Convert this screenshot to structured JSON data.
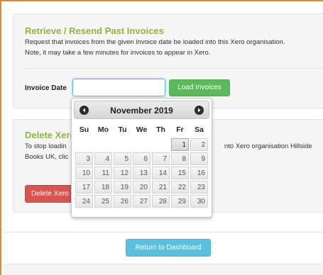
{
  "retrieve": {
    "title": "Retrieve / Resend Past Invoices",
    "description_line1": "Request that invoices from the given invoice date be loaded into this Xero organisation.",
    "description_line2": "Note, it may take a few minutes for invoices to appear in Xero.",
    "invoice_date_label": "Invoice Date",
    "invoice_date_value": "",
    "load_button": "Load Invoices"
  },
  "delete": {
    "title": "Delete Xero",
    "description_line1_left": "To stop loadin",
    "description_line1_right": "nto Xero organisation Hillside",
    "description_line2": "Books UK, clic",
    "delete_button": "Delete Xero"
  },
  "footer": {
    "dashboard_button": "Return to Dashboard"
  },
  "datepicker": {
    "month_title": "November 2019",
    "weekdays": [
      "Su",
      "Mo",
      "Tu",
      "We",
      "Th",
      "Fr",
      "Sa"
    ],
    "weeks": [
      [
        "",
        "",
        "",
        "",
        "",
        "1",
        "2"
      ],
      [
        "3",
        "4",
        "5",
        "6",
        "7",
        "8",
        "9"
      ],
      [
        "10",
        "11",
        "12",
        "13",
        "14",
        "15",
        "16"
      ],
      [
        "17",
        "18",
        "19",
        "20",
        "21",
        "22",
        "23"
      ],
      [
        "24",
        "25",
        "26",
        "27",
        "28",
        "29",
        "30"
      ]
    ],
    "selected_day": "1"
  },
  "colors": {
    "frame_border": "#e08a2b",
    "title_green": "#8cb83c",
    "load_green": "#5cb85c",
    "delete_red": "#d9534f",
    "dashboard_blue": "#5bc0de"
  }
}
